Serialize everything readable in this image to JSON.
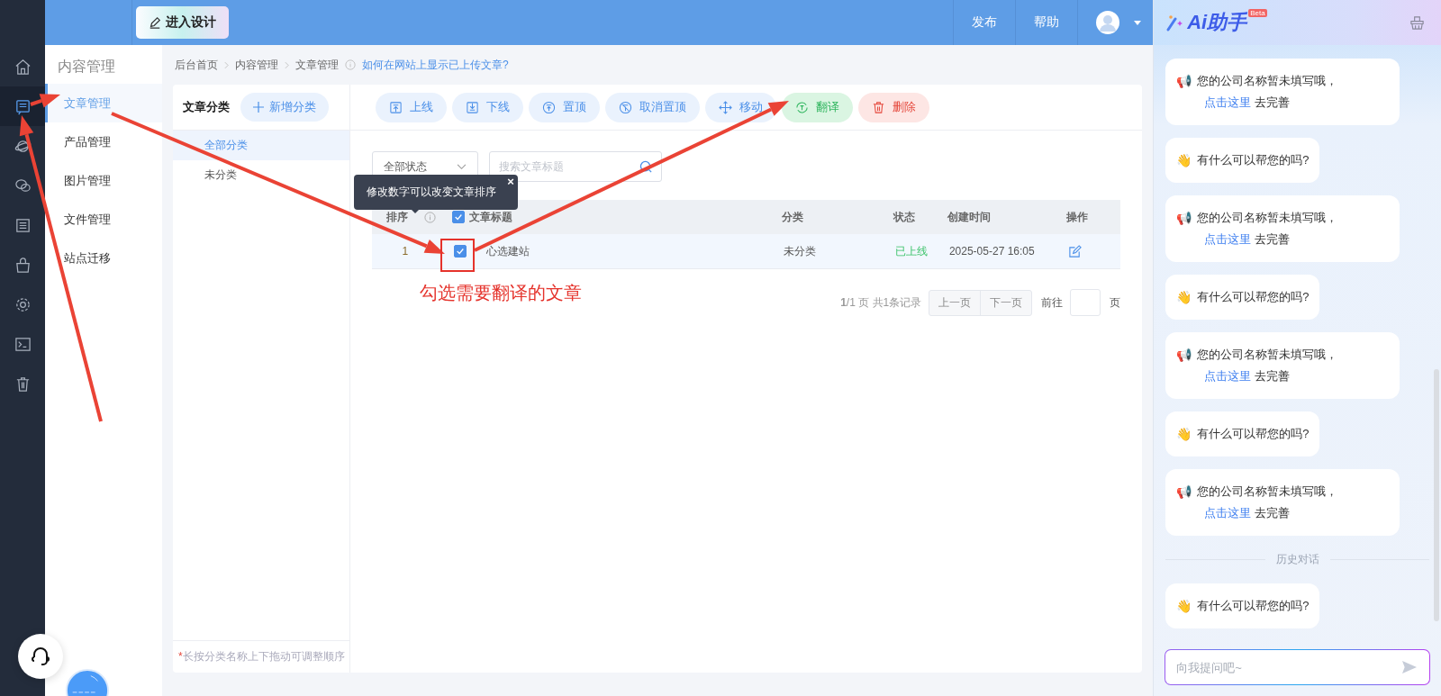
{
  "topbar": {
    "design_button": "进入设计",
    "actions": [
      "发布",
      "帮助"
    ]
  },
  "nav": [
    {
      "kind": "home",
      "selected": false
    },
    {
      "kind": "article",
      "selected": true
    },
    {
      "kind": "planet",
      "selected": false
    },
    {
      "kind": "chat",
      "selected": false
    },
    {
      "kind": "list",
      "selected": false
    },
    {
      "kind": "bag",
      "selected": false
    },
    {
      "kind": "gear",
      "selected": false
    },
    {
      "kind": "terminal",
      "selected": false
    },
    {
      "kind": "trash",
      "selected": false
    }
  ],
  "submenu": {
    "title": "内容管理",
    "items": [
      {
        "label": "文章管理",
        "selected": true
      },
      {
        "label": "产品管理",
        "selected": false
      },
      {
        "label": "图片管理",
        "selected": false
      },
      {
        "label": "文件管理",
        "selected": false
      },
      {
        "label": "站点迁移",
        "selected": false
      }
    ]
  },
  "breadcrumb": [
    "后台首页",
    "内容管理",
    "文章管理"
  ],
  "help_link": "如何在网站上显示已上传文章?",
  "categories": {
    "title": "文章分类",
    "add_button": "新增分类",
    "items": [
      {
        "label": "全部分类",
        "selected": true
      },
      {
        "label": "未分类",
        "selected": false
      }
    ],
    "footnote_mark": "*",
    "footnote": "长按分类名称上下拖动可调整顺序"
  },
  "toolbar": [
    {
      "kind": "online",
      "label": "上线"
    },
    {
      "kind": "offline",
      "label": "下线"
    },
    {
      "kind": "pin",
      "label": "置顶"
    },
    {
      "kind": "unpin",
      "label": "取消置顶"
    },
    {
      "kind": "move",
      "label": "移动"
    },
    {
      "kind": "translate",
      "label": "翻译"
    },
    {
      "kind": "delete",
      "label": "删除"
    }
  ],
  "filters": {
    "status": "全部状态",
    "search_placeholder": "搜索文章标题"
  },
  "tooltip": {
    "text": "修改数字可以改变文章排序",
    "close": "×"
  },
  "table": {
    "columns": [
      "排序",
      "文章标题",
      "分类",
      "状态",
      "创建时间",
      "操作"
    ],
    "header_checked": true,
    "rows": [
      {
        "order": "1",
        "checked": true,
        "title": "心选建站",
        "category": "未分类",
        "status": "已上线",
        "created": "2025-05-27 16:05"
      }
    ]
  },
  "pagination": {
    "summary": "**1**/1 页 共1条记录",
    "prev": "上一页",
    "next": "下一页",
    "goto": "前往",
    "unit": "页"
  },
  "annotation": {
    "caption": "勾选需要翻译的文章"
  },
  "assistant": {
    "title": "Ai助手",
    "badge": "Beta",
    "messages": [
      {
        "kind": "notice",
        "emoji": "📢",
        "text": "您的公司名称暂未填写哦，",
        "link": "点击这里",
        "after": "去完善"
      },
      {
        "kind": "greeting",
        "emoji": "👋",
        "text": "有什么可以帮您的吗?"
      },
      {
        "kind": "notice",
        "emoji": "📢",
        "text": "您的公司名称暂未填写哦，",
        "link": "点击这里",
        "after": "去完善"
      },
      {
        "kind": "greeting",
        "emoji": "👋",
        "text": "有什么可以帮您的吗?"
      },
      {
        "kind": "notice",
        "emoji": "📢",
        "text": "您的公司名称暂未填写哦，",
        "link": "点击这里",
        "after": "去完善"
      },
      {
        "kind": "greeting",
        "emoji": "👋",
        "text": "有什么可以帮您的吗?"
      },
      {
        "kind": "notice",
        "emoji": "📢",
        "text": "您的公司名称暂未填写哦，",
        "link": "点击这里",
        "after": "去完善"
      },
      {
        "kind": "divider",
        "text": "历史对话"
      },
      {
        "kind": "greeting",
        "emoji": "👋",
        "text": "有什么可以帮您的吗?"
      }
    ],
    "input_placeholder": "向我提问吧~"
  }
}
